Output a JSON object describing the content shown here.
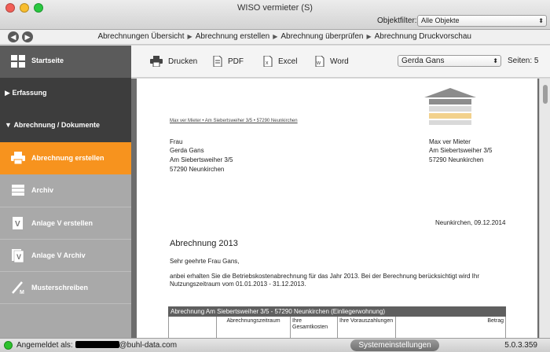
{
  "window": {
    "title": "WISO vermieter (S)",
    "filter_label": "Objektfilter:",
    "filter_value": "Alle Objekte"
  },
  "breadcrumb": [
    "Abrechnungen Übersicht",
    "Abrechnung erstellen",
    "Abrechnung überprüfen",
    "Abrechnung Druckvorschau"
  ],
  "sidebar": {
    "start": "Startseite",
    "section_erfassung": "Erfassung",
    "section_abrechnung": "Abrechnung / Dokumente",
    "items": [
      {
        "label": "Abrechnung erstellen",
        "icon": "printer-icon",
        "active": true
      },
      {
        "label": "Archiv",
        "icon": "archive-icon",
        "active": false
      },
      {
        "label": "Anlage V erstellen",
        "icon": "form-icon",
        "active": false
      },
      {
        "label": "Anlage V Archiv",
        "icon": "form-archive-icon",
        "active": false
      },
      {
        "label": "Musterschreiben",
        "icon": "pen-icon",
        "active": false
      }
    ]
  },
  "toolbar": {
    "print": "Drucken",
    "pdf": "PDF",
    "excel": "Excel",
    "word": "Word",
    "person": "Gerda Gans",
    "pages_label": "Seiten: 5"
  },
  "document": {
    "sender_line": "Max ver Mieter • Am Siebertsweiher 3/5 • 57290 Neunkirchen",
    "recipient": [
      "Frau",
      "Gerda Gans",
      "Am Siebertsweiher 3/5",
      "57290 Neunkirchen"
    ],
    "sender": [
      "Max ver Mieter",
      "Am Siebertsweiher 3/5",
      "57290 Neunkirchen"
    ],
    "date": "Neunkirchen, 09.12.2014",
    "title": "Abrechnung 2013",
    "salutation": "Sehr geehrte Frau Gans,",
    "body_line1": "anbei erhalten Sie die Betriebskostenabrechnung für das Jahr 2013. Bei der Berechnung berücksichtigt wird Ihr",
    "body_line2": "Nutzungszeitraum vom 01.01.2013 - 31.12.2013.",
    "table_title": "Abrechnung Am Siebertsweiher 3/5 - 57290 Neunkirchen (Einliegerwohnung)",
    "table_columns": [
      "Abrechnungszeitraum",
      "Ihre Gesamtkosten",
      "Ihre Vorauszahlungen",
      "Betrag"
    ]
  },
  "status": {
    "logged_in_prefix": "Angemeldet als:",
    "email_suffix": "@buhl-data.com",
    "system_button": "Systemeinstellungen",
    "version": "5.0.3.359"
  },
  "colors": {
    "accent": "#f7931e",
    "sidebar_dark": "#3d3d3d",
    "status_green": "#2cc12c"
  }
}
